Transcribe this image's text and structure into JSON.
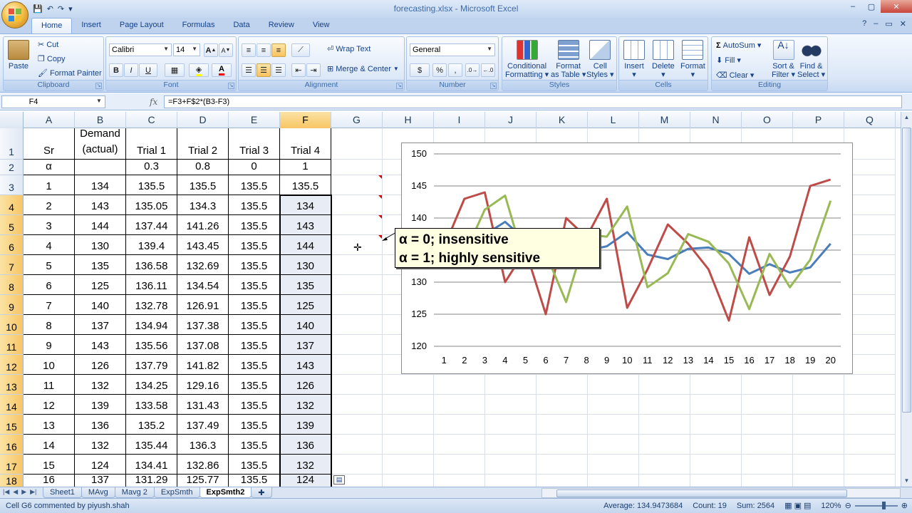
{
  "window": {
    "title": "forecasting.xlsx - Microsoft Excel",
    "controls": [
      "–",
      "▢",
      "✕"
    ]
  },
  "qat": [
    "💾",
    "↶",
    "↷",
    "▾"
  ],
  "ribbon_tabs": [
    "Home",
    "Insert",
    "Page Layout",
    "Formulas",
    "Data",
    "Review",
    "View"
  ],
  "ribbon": {
    "clipboard": {
      "label": "Clipboard",
      "paste": "Paste",
      "cut": "Cut",
      "copy": "Copy",
      "format_painter": "Format Painter"
    },
    "font": {
      "label": "Font",
      "font_name": "Calibri",
      "font_size": "14",
      "grow": "A",
      "shrink": "A",
      "bold": "B",
      "italic": "I",
      "underline": "U"
    },
    "alignment": {
      "label": "Alignment",
      "wrap_text": "Wrap Text",
      "merge_center": "Merge & Center"
    },
    "number": {
      "label": "Number",
      "format": "General",
      "currency": "$",
      "percent": "%",
      "comma": ","
    },
    "styles": {
      "label": "Styles",
      "conditional": "Conditional\nFormatting ▾",
      "format_table": "Format\nas Table ▾",
      "cell_styles": "Cell\nStyles ▾"
    },
    "cells": {
      "label": "Cells",
      "insert": "Insert\n▾",
      "delete": "Delete\n▾",
      "format": "Format\n▾"
    },
    "editing": {
      "label": "Editing",
      "autosum": "AutoSum ▾",
      "fill": "Fill ▾",
      "clear": "Clear ▾",
      "sort_filter": "Sort &\nFilter ▾",
      "find_select": "Find &\nSelect ▾"
    }
  },
  "formula_bar": {
    "name_box": "F4",
    "fx": "fx",
    "formula": "=F3+F$2*(B3-F3)"
  },
  "columns": [
    "A",
    "B",
    "C",
    "D",
    "E",
    "F",
    "G",
    "H",
    "I",
    "J",
    "K",
    "L",
    "M",
    "N",
    "O",
    "P",
    "Q"
  ],
  "rows": [
    "1",
    "2",
    "3",
    "4",
    "5",
    "6",
    "7",
    "8",
    "9",
    "10",
    "11",
    "12",
    "13",
    "14",
    "15",
    "16",
    "17",
    "18"
  ],
  "sheet": {
    "r1": [
      "Sr",
      "Demand (actual)",
      "Trial 1",
      "Trial 2",
      "Trial 3",
      "Trial 4"
    ],
    "r2": [
      "α",
      "",
      "0.3",
      "0.8",
      "0",
      "1"
    ],
    "data": [
      [
        "1",
        "134",
        "135.5",
        "135.5",
        "135.5",
        "135.5"
      ],
      [
        "2",
        "143",
        "135.05",
        "134.3",
        "135.5",
        "134"
      ],
      [
        "3",
        "144",
        "137.44",
        "141.26",
        "135.5",
        "143"
      ],
      [
        "4",
        "130",
        "139.4",
        "143.45",
        "135.5",
        "144"
      ],
      [
        "5",
        "135",
        "136.58",
        "132.69",
        "135.5",
        "130"
      ],
      [
        "6",
        "125",
        "136.11",
        "134.54",
        "135.5",
        "135"
      ],
      [
        "7",
        "140",
        "132.78",
        "126.91",
        "135.5",
        "125"
      ],
      [
        "8",
        "137",
        "134.94",
        "137.38",
        "135.5",
        "140"
      ],
      [
        "9",
        "143",
        "135.56",
        "137.08",
        "135.5",
        "137"
      ],
      [
        "10",
        "126",
        "137.79",
        "141.82",
        "135.5",
        "143"
      ],
      [
        "11",
        "132",
        "134.25",
        "129.16",
        "135.5",
        "126"
      ],
      [
        "12",
        "139",
        "133.58",
        "131.43",
        "135.5",
        "132"
      ],
      [
        "13",
        "136",
        "135.2",
        "137.49",
        "135.5",
        "139"
      ],
      [
        "14",
        "132",
        "135.44",
        "136.3",
        "135.5",
        "136"
      ],
      [
        "15",
        "124",
        "134.41",
        "132.86",
        "135.5",
        "132"
      ],
      [
        "16",
        "137",
        "131.29",
        "125.77",
        "135.5",
        "124"
      ]
    ]
  },
  "comment": {
    "line1": "α = 0; insensitive",
    "line2": "α = 1; highly sensitive"
  },
  "chart_data": {
    "type": "line",
    "x": [
      "1",
      "2",
      "3",
      "4",
      "5",
      "6",
      "7",
      "8",
      "9",
      "10",
      "11",
      "12",
      "13",
      "14",
      "15",
      "16",
      "17",
      "18",
      "19",
      "20"
    ],
    "ylim": [
      120,
      150
    ],
    "yticks": [
      "120",
      "125",
      "130",
      "135",
      "140",
      "145",
      "150"
    ],
    "grid": true,
    "series": [
      {
        "color": "#4a7ebb",
        "values": [
          135.5,
          135.0,
          137.4,
          139.4,
          136.6,
          136.1,
          132.8,
          134.9,
          135.6,
          137.8,
          134.3,
          133.6,
          135.2,
          135.4,
          134.4,
          131.3,
          132.8,
          131.5,
          132.3,
          136.0
        ]
      },
      {
        "color": "#be4b48",
        "values": [
          135.5,
          143.0,
          144.0,
          130.0,
          135.0,
          125.0,
          140.0,
          137.0,
          143.0,
          126.0,
          132.0,
          139.0,
          136.0,
          132.0,
          124.0,
          137.0,
          128.0,
          134.0,
          145.0,
          146.0
        ]
      },
      {
        "color": "#98b954",
        "values": [
          135.5,
          134.3,
          141.3,
          143.5,
          132.7,
          134.5,
          126.9,
          137.4,
          137.1,
          141.8,
          129.2,
          131.4,
          137.5,
          136.3,
          132.9,
          125.8,
          134.4,
          129.2,
          133.5,
          142.7
        ]
      }
    ]
  },
  "sheet_tabs": [
    "Sheet1",
    "MAvg",
    "Mavg 2",
    "ExpSmth",
    "ExpSmth2"
  ],
  "status": {
    "left": "Cell G6 commented by piyush.shah",
    "average": "Average: 134.9473684",
    "count": "Count: 19",
    "sum": "Sum: 2564",
    "zoom": "120%"
  }
}
